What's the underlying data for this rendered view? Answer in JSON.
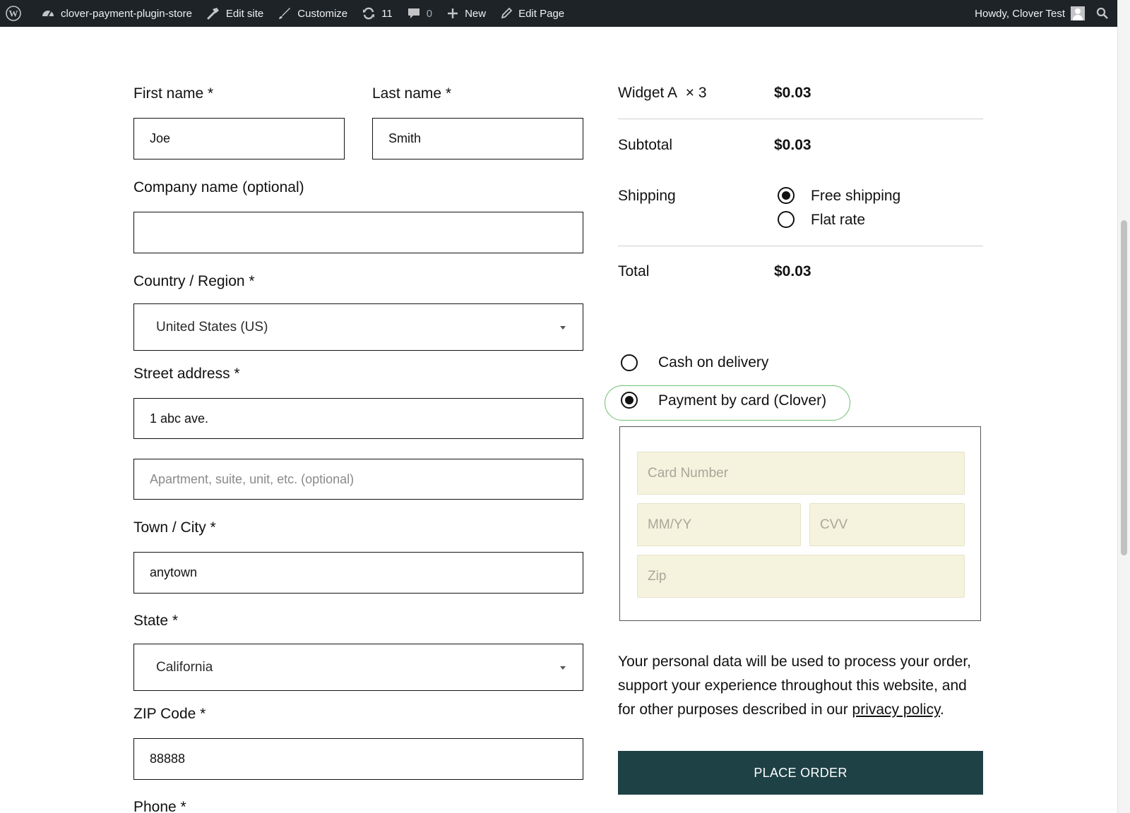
{
  "admin_bar": {
    "site_name": "clover-payment-plugin-store",
    "edit_site": "Edit site",
    "customize": "Customize",
    "updates_count": "11",
    "comments_count": "0",
    "new": "New",
    "edit_page": "Edit Page",
    "howdy": "Howdy, Clover Test"
  },
  "billing": {
    "first_name": {
      "label": "First name *",
      "value": "Joe"
    },
    "last_name": {
      "label": "Last name *",
      "value": "Smith"
    },
    "company": {
      "label": "Company name (optional)",
      "value": ""
    },
    "country": {
      "label": "Country / Region *",
      "value": "United States (US)"
    },
    "street": {
      "label": "Street address *",
      "value": "1 abc ave.",
      "apt_placeholder": "Apartment, suite, unit, etc. (optional)"
    },
    "city": {
      "label": "Town / City *",
      "value": "anytown"
    },
    "state": {
      "label": "State *",
      "value": "California"
    },
    "zip": {
      "label": "ZIP Code *",
      "value": "88888"
    },
    "phone": {
      "label": "Phone *"
    }
  },
  "order": {
    "item_name": "Widget A",
    "item_qty": "× 3",
    "item_total": "$0.03",
    "subtotal_label": "Subtotal",
    "subtotal": "$0.03",
    "shipping_label": "Shipping",
    "shipping_options": [
      "Free shipping",
      "Flat rate"
    ],
    "shipping_selected": "Free shipping",
    "total_label": "Total",
    "total": "$0.03"
  },
  "payment": {
    "methods": [
      "Cash on delivery",
      "Payment by card (Clover)"
    ],
    "selected": "Payment by card (Clover)",
    "card": {
      "number_placeholder": "Card Number",
      "expiry_placeholder": "MM/YY",
      "cvv_placeholder": "CVV",
      "zip_placeholder": "Zip"
    },
    "highlight_color": "#6fbf6f",
    "card_field_bg": "#f5f3dd"
  },
  "privacy": {
    "text": "Your personal data will be used to process your order, support your experience throughout this website, and for other purposes described in our",
    "link": "privacy policy",
    "end": "."
  },
  "place_order": {
    "label": "PLACE ORDER",
    "color": "#1e4146"
  },
  "colors": {
    "admin_bar": "#1d2327"
  }
}
